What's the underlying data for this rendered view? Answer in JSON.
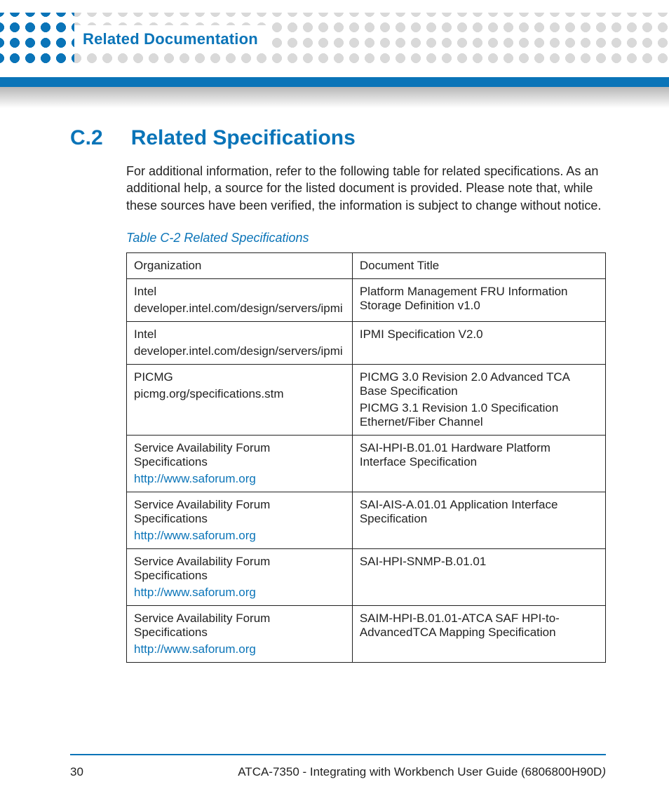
{
  "header": {
    "breadcrumb": "Related Documentation"
  },
  "section": {
    "number": "C.2",
    "title": "Related Specifications",
    "intro": "For additional information, refer to the following table for related specifications. As an additional help, a source for the listed document is provided. Please note that, while these sources have been verified, the information is subject to change without notice."
  },
  "table": {
    "caption": "Table C-2 Related Specifications",
    "headers": [
      "Organization",
      "Document Title"
    ],
    "rows": [
      {
        "org": "Intel",
        "org_sub": "developer.intel.com/design/servers/ipmi",
        "org_is_link": false,
        "doc": "Platform Management FRU Information Storage Definition v1.0"
      },
      {
        "org": "Intel",
        "org_sub": "developer.intel.com/design/servers/ipmi",
        "org_is_link": false,
        "doc": "IPMI Specification V2.0"
      },
      {
        "org": "PICMG",
        "org_sub": "picmg.org/specifications.stm",
        "org_is_link": false,
        "doc": "PICMG 3.0 Revision 2.0 Advanced TCA Base Specification\nPICMG 3.1 Revision 1.0 Specification Ethernet/Fiber Channel"
      },
      {
        "org": "Service Availability Forum Specifications",
        "org_sub": "http://www.saforum.org",
        "org_is_link": true,
        "doc": "SAI-HPI-B.01.01 Hardware Platform Interface Specification"
      },
      {
        "org": "Service Availability Forum Specifications",
        "org_sub": "http://www.saforum.org",
        "org_is_link": true,
        "doc": "SAI-AIS-A.01.01 Application Interface Specification"
      },
      {
        "org": "Service Availability Forum Specifications",
        "org_sub": "http://www.saforum.org",
        "org_is_link": true,
        "doc": "SAI-HPI-SNMP-B.01.01"
      },
      {
        "org": "Service Availability Forum Specifications",
        "org_sub": "http://www.saforum.org",
        "org_is_link": true,
        "doc": "SAIM-HPI-B.01.01-ATCA SAF HPI-to-AdvancedTCA Mapping Specification"
      }
    ]
  },
  "footer": {
    "page": "30",
    "doc_title": "ATCA-7350 - Integrating with Workbench User Guide (6806800H90D",
    "closing_paren": ")"
  }
}
